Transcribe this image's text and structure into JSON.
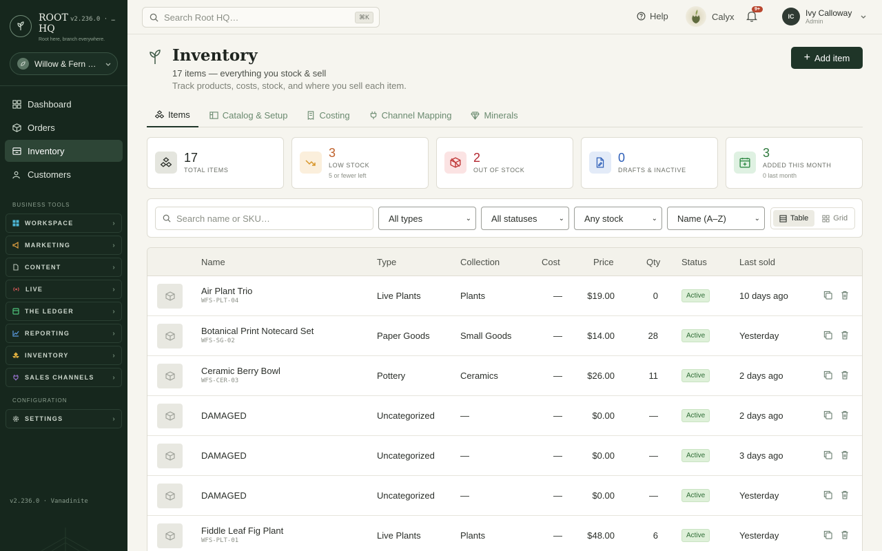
{
  "brand": {
    "name": "ROOT HQ",
    "version": "v2.236.0 · …",
    "tagline": "Root here, branch everywhere."
  },
  "store": {
    "name": "Willow & Fern …"
  },
  "nav": [
    {
      "label": "Dashboard",
      "icon": "dashboard-icon"
    },
    {
      "label": "Orders",
      "icon": "box-icon"
    },
    {
      "label": "Inventory",
      "icon": "inventory-icon",
      "active": true
    },
    {
      "label": "Customers",
      "icon": "users-icon"
    }
  ],
  "sections": {
    "business_tools": "BUSINESS TOOLS",
    "configuration": "CONFIGURATION"
  },
  "tools": [
    {
      "label": "WORKSPACE",
      "color": "#4db6d6"
    },
    {
      "label": "MARKETING",
      "color": "#e0a040"
    },
    {
      "label": "CONTENT",
      "color": "#b9c4b8"
    },
    {
      "label": "LIVE",
      "color": "#e05a5a"
    },
    {
      "label": "THE LEDGER",
      "color": "#4ec27a"
    },
    {
      "label": "REPORTING",
      "color": "#5a9be0"
    },
    {
      "label": "INVENTORY",
      "color": "#e0b040"
    },
    {
      "label": "SALES CHANNELS",
      "color": "#a57ae0"
    }
  ],
  "settings_tool": {
    "label": "SETTINGS"
  },
  "sidebar_footer": "v2.236.0 · Vanadinite",
  "topbar": {
    "search_placeholder": "Search Root HQ…",
    "shortcut": "⌘K",
    "help": "Help",
    "assistant": "Calyx",
    "notif_count": "9+",
    "user_initials": "IC",
    "user_name": "Ivy Calloway",
    "user_role": "Admin"
  },
  "page": {
    "title": "Inventory",
    "subtitle": "17 items — everything you stock & sell",
    "description": "Track products, costs, stock, and where you sell each item.",
    "add_button": "Add item"
  },
  "tabs": [
    {
      "label": "Items",
      "active": true
    },
    {
      "label": "Catalog & Setup"
    },
    {
      "label": "Costing"
    },
    {
      "label": "Channel Mapping"
    },
    {
      "label": "Minerals"
    }
  ],
  "stats": [
    {
      "value": "17",
      "label": "TOTAL ITEMS",
      "sub": "",
      "color": "#1f2520"
    },
    {
      "value": "3",
      "label": "LOW STOCK",
      "sub": "5 or fewer left",
      "color": "#c0622c"
    },
    {
      "value": "2",
      "label": "OUT OF STOCK",
      "sub": "",
      "color": "#b3262f"
    },
    {
      "value": "0",
      "label": "DRAFTS & INACTIVE",
      "sub": "",
      "color": "#2e5fb8"
    },
    {
      "value": "3",
      "label": "ADDED THIS MONTH",
      "sub": "0 last month",
      "color": "#2f7a3e"
    }
  ],
  "filters": {
    "search_placeholder": "Search name or SKU…",
    "type": "All types",
    "status": "All statuses",
    "stock": "Any stock",
    "sort": "Name (A–Z)",
    "view_table": "Table",
    "view_grid": "Grid"
  },
  "table": {
    "headers": {
      "name": "Name",
      "type": "Type",
      "collection": "Collection",
      "cost": "Cost",
      "price": "Price",
      "qty": "Qty",
      "status": "Status",
      "last_sold": "Last sold"
    },
    "rows": [
      {
        "name": "Air Plant Trio",
        "sku": "WFS-PLT-04",
        "type": "Live Plants",
        "collection": "Plants",
        "cost": "—",
        "price": "$19.00",
        "qty": "0",
        "status": "Active",
        "last_sold": "10 days ago"
      },
      {
        "name": "Botanical Print Notecard Set",
        "sku": "WFS-SG-02",
        "type": "Paper Goods",
        "collection": "Small Goods",
        "cost": "—",
        "price": "$14.00",
        "qty": "28",
        "status": "Active",
        "last_sold": "Yesterday"
      },
      {
        "name": "Ceramic Berry Bowl",
        "sku": "WFS-CER-03",
        "type": "Pottery",
        "collection": "Ceramics",
        "cost": "—",
        "price": "$26.00",
        "qty": "11",
        "status": "Active",
        "last_sold": "2 days ago"
      },
      {
        "name": "DAMAGED",
        "sku": "",
        "type": "Uncategorized",
        "collection": "—",
        "cost": "—",
        "price": "$0.00",
        "qty": "—",
        "status": "Active",
        "last_sold": "2 days ago"
      },
      {
        "name": "DAMAGED",
        "sku": "",
        "type": "Uncategorized",
        "collection": "—",
        "cost": "—",
        "price": "$0.00",
        "qty": "—",
        "status": "Active",
        "last_sold": "3 days ago"
      },
      {
        "name": "DAMAGED",
        "sku": "",
        "type": "Uncategorized",
        "collection": "—",
        "cost": "—",
        "price": "$0.00",
        "qty": "—",
        "status": "Active",
        "last_sold": "Yesterday"
      },
      {
        "name": "Fiddle Leaf Fig Plant",
        "sku": "WFS-PLT-01",
        "type": "Live Plants",
        "collection": "Plants",
        "cost": "—",
        "price": "$48.00",
        "qty": "6",
        "status": "Active",
        "last_sold": "Yesterday"
      }
    ]
  }
}
